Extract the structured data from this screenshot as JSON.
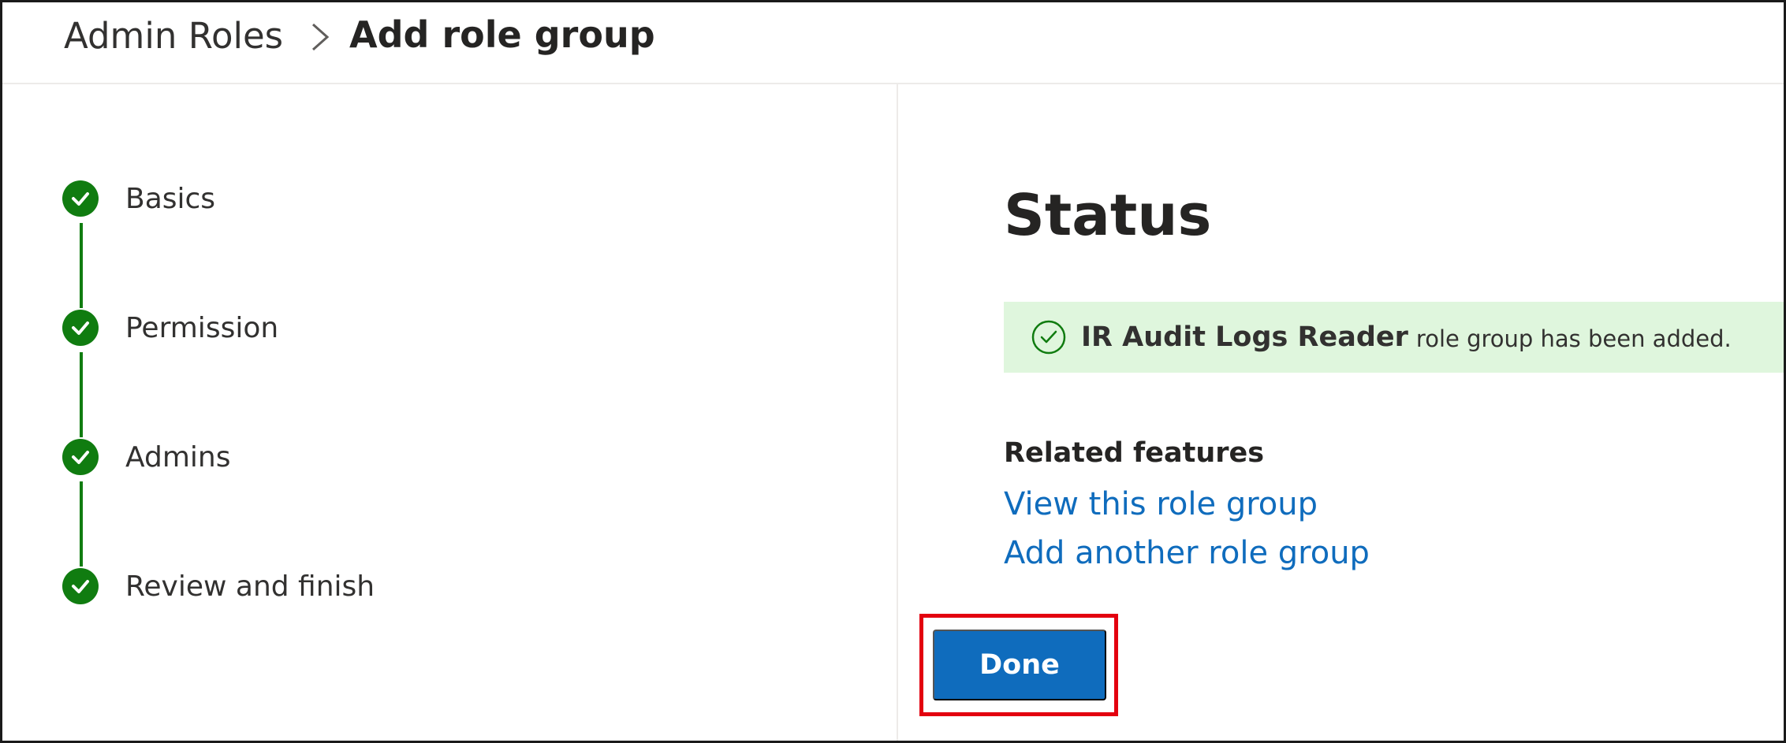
{
  "breadcrumb": {
    "root": "Admin Roles",
    "current": "Add role group"
  },
  "steps": [
    {
      "label": "Basics",
      "state": "complete"
    },
    {
      "label": "Permission",
      "state": "complete"
    },
    {
      "label": "Admins",
      "state": "complete"
    },
    {
      "label": "Review and finish",
      "state": "complete"
    }
  ],
  "status": {
    "title": "Status",
    "banner_strong": "IR Audit Logs Reader",
    "banner_text": "role group has been added."
  },
  "related": {
    "heading": "Related features",
    "links": [
      {
        "label": "View this role group"
      },
      {
        "label": "Add another role group"
      }
    ]
  },
  "actions": {
    "done_label": "Done"
  },
  "colors": {
    "success_green": "#107c10",
    "banner_bg": "#dff6dd",
    "link_blue": "#0f6cbd",
    "primary_button": "#0f6cbd",
    "highlight_red": "#e3000f"
  },
  "icons": {
    "step_complete": "checkmark-circle-icon",
    "banner": "checkmark-outline-circle-icon",
    "breadcrumb_separator": "chevron-right-icon"
  }
}
